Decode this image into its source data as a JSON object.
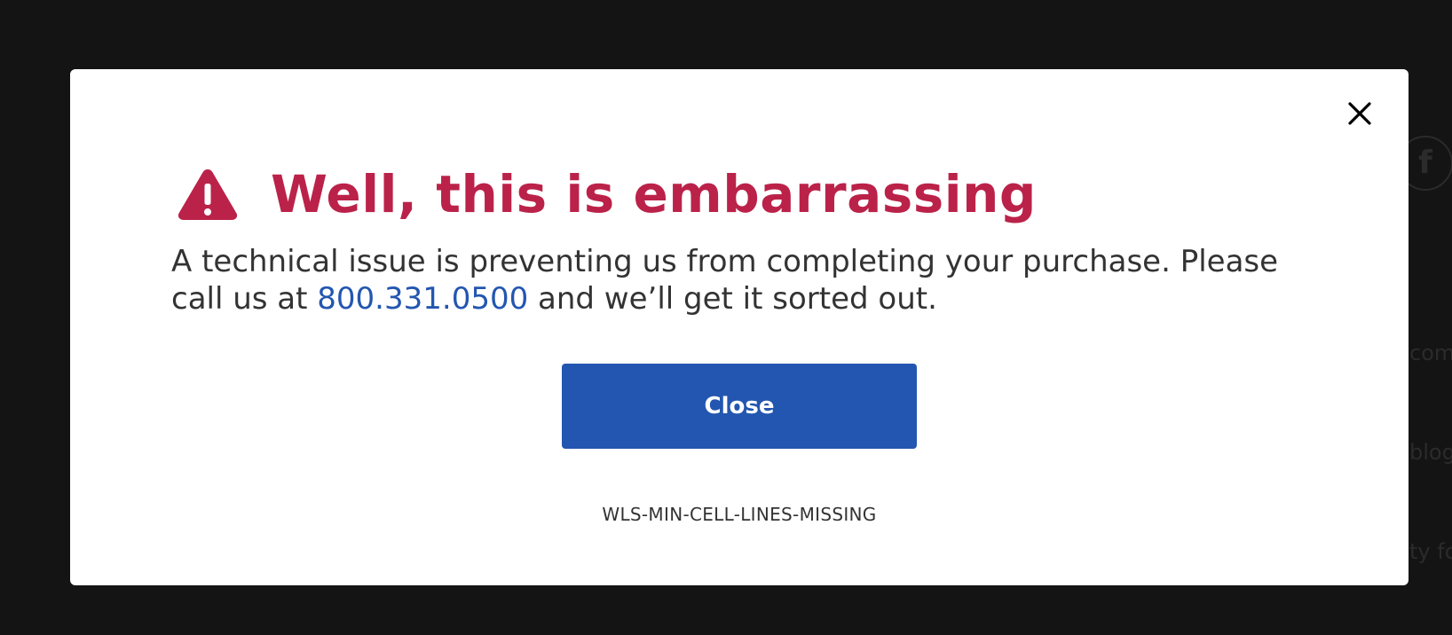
{
  "background": {
    "fragment_1": "com",
    "fragment_2": "blog",
    "fragment_3": "ty fo",
    "social_icon": "facebook-icon",
    "social_icon_glyph": "f"
  },
  "dialog": {
    "close_icon": "close-icon",
    "warning_icon": "warning-triangle-icon",
    "heading": "Well, this is embarrassing",
    "message_before": "A technical issue is preventing us from completing your purchase. Please call us at ",
    "phone": "800.331.0500",
    "message_after": " and we’ll get it sorted out.",
    "button_label": "Close",
    "error_code": "WLS-MIN-CELL-LINES-MISSING"
  },
  "colors": {
    "overlay": "#141414",
    "heading": "#bb2249",
    "accent": "#2356b0",
    "text": "#333333"
  }
}
